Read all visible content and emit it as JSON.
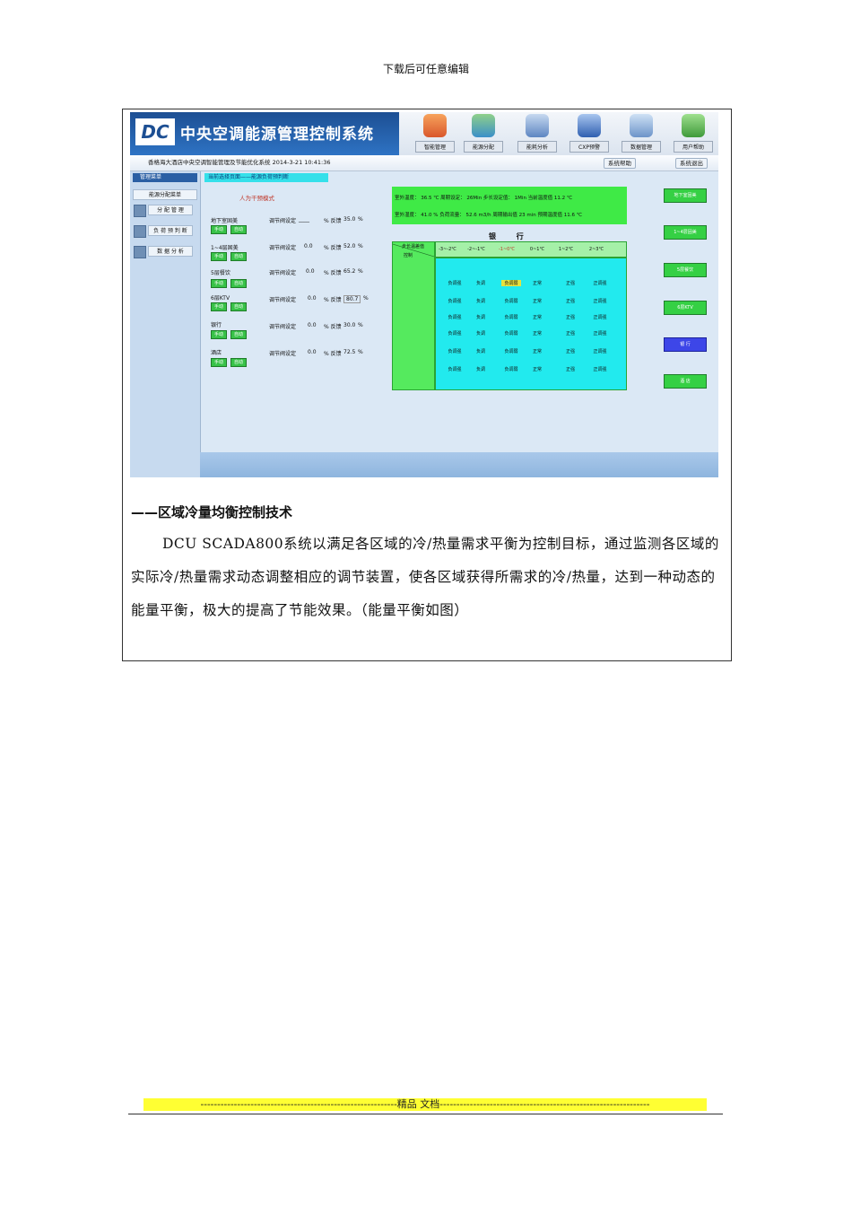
{
  "top_note": "下载后可任意编辑",
  "screenshot": {
    "logo_text": "DC",
    "system_title": "中央空调能源管理控制系统",
    "nav_buttons": [
      "智能管理",
      "能源分配",
      "能耗分析",
      "CXP预警",
      "数据管理",
      "用户帮助"
    ],
    "subbar": {
      "left_text": "香格海大酒店中央空调智能管理及节能优化系统  2014-3-21 10:41:36",
      "help": "系统帮助",
      "exit": "系统退出"
    },
    "sidebar": {
      "header": "管理菜单",
      "items": [
        "能源分配菜单",
        "分 配 管 理",
        "负 荷 预 判 断",
        "数 据 分 析"
      ]
    },
    "content": {
      "current_page": "当前选择页面——能源负荷预判断",
      "mode": "人为干预模式",
      "zones": [
        {
          "name": "地下室固美",
          "setting": "____",
          "feedback": "35.0"
        },
        {
          "name": "1~4层固美",
          "setting": "0.0",
          "feedback": "52.0"
        },
        {
          "name": "5层餐饮",
          "setting": "0.0",
          "feedback": "65.2"
        },
        {
          "name": "6层KTV",
          "setting": "0.0",
          "feedback": "80.7"
        },
        {
          "name": "银行",
          "setting": "0.0",
          "feedback": "30.0"
        },
        {
          "name": "酒店",
          "setting": "0.0",
          "feedback": "72.5"
        }
      ],
      "labels": {
        "manual": "手动",
        "auto": "自动",
        "valve_setting": "调节阀设定",
        "feedback": "% 反馈",
        "percent": "%"
      },
      "info": {
        "row1": "室外温度： 36.5 ℃   周期设定： 26Min     步长设定值： 1Min    当前温度值  11.2 ℃",
        "row2": "室外湿度： 41.0 %   负荷流量：  52.6  m3/h  周期输出值  23  min  预期温度值  11.6 ℃"
      },
      "bank_title": "银 行",
      "table": {
        "corner_top": "步长温差值",
        "corner_bottom": "控制",
        "columns": [
          "-3~-2℃",
          "-2~-1℃",
          "-1~0℃",
          "0~1℃",
          "1~2℃",
          "2~3℃"
        ],
        "rows": [
          [
            "负调强",
            "负调",
            "负调弱",
            "正常",
            "正强",
            "正调强"
          ],
          [
            "负调强",
            "负调",
            "负调弱",
            "正常",
            "正强",
            "正调强"
          ],
          [
            "负调强",
            "负调",
            "负调弱",
            "正常",
            "正强",
            "正调强"
          ],
          [
            "负调强",
            "负调",
            "负调弱",
            "正常",
            "正强",
            "正调强"
          ],
          [
            "负调强",
            "负调",
            "负调弱",
            "正常",
            "正强",
            "正调强"
          ],
          [
            "负调强",
            "负调",
            "负调弱",
            "正常",
            "正强",
            "正调强"
          ]
        ]
      },
      "zone_buttons": [
        "地下室固美",
        "1~4层固美",
        "5层餐饮",
        "6层KTV",
        "银 行",
        "酒 店"
      ]
    }
  },
  "heading": "——区域冷量均衡控制技术",
  "paragraph": "DCU SCADA800系统以满足各区域的冷/热量需求平衡为控制目标，通过监测各区域的实际冷/热量需求动态调整相应的调节装置，使各区域获得所需求的冷/热量，达到一种动态的能量平衡，极大的提高了节能效果。（能量平衡如图）",
  "footer": "-----------------------------------------------------------精品   文档---------------------------------------------------------------"
}
